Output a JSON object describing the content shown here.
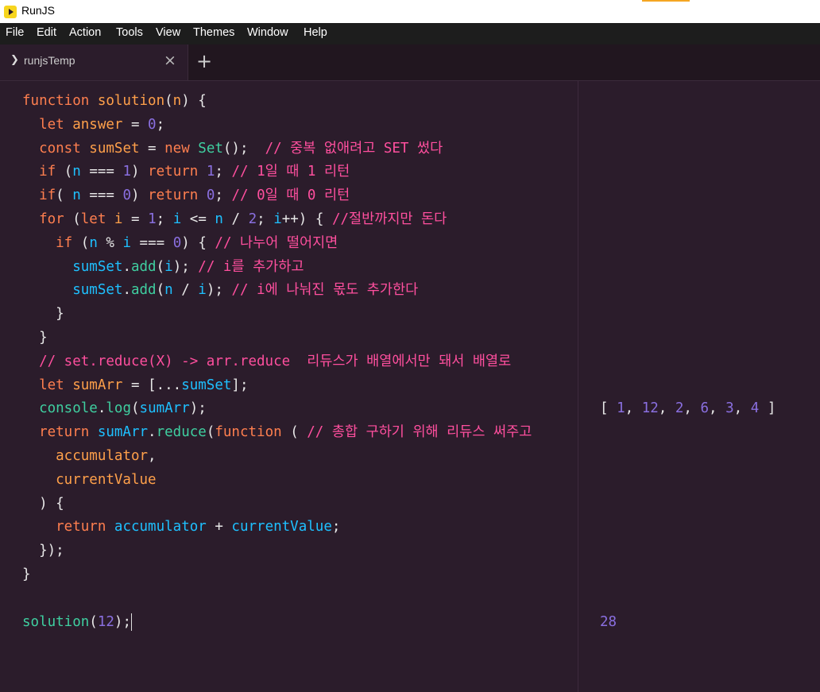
{
  "window": {
    "title": "RunJS"
  },
  "menu": [
    "File",
    "Edit",
    "Action",
    "Tools",
    "View",
    "Themes",
    "Window",
    "Help"
  ],
  "tab": {
    "name": "runjsTemp",
    "close_icon": "×",
    "chevron": "❯",
    "new_tab_icon": "+"
  },
  "code": [
    [
      [
        "function ",
        "kw"
      ],
      [
        "solution",
        "fn"
      ],
      [
        "(",
        "pl"
      ],
      [
        "n",
        "fn"
      ],
      [
        ") {",
        "pl"
      ]
    ],
    [
      [
        "  let ",
        "kw"
      ],
      [
        "answer",
        "fn"
      ],
      [
        " = ",
        "pl"
      ],
      [
        "0",
        "num"
      ],
      [
        ";",
        "pl"
      ]
    ],
    [
      [
        "  const ",
        "kw"
      ],
      [
        "sumSet",
        "fn"
      ],
      [
        " = ",
        "pl"
      ],
      [
        "new ",
        "kw"
      ],
      [
        "Set",
        "bi"
      ],
      [
        "();  ",
        "pl"
      ],
      [
        "// 중복 없애려고 SET 썼다",
        "cmt"
      ]
    ],
    [
      [
        "  if ",
        "kw"
      ],
      [
        "(",
        "pl"
      ],
      [
        "n",
        "id"
      ],
      [
        " === ",
        "pl"
      ],
      [
        "1",
        "num"
      ],
      [
        ") ",
        "pl"
      ],
      [
        "return ",
        "kw"
      ],
      [
        "1",
        "num"
      ],
      [
        "; ",
        "pl"
      ],
      [
        "// 1일 때 1 리턴",
        "cmt"
      ]
    ],
    [
      [
        "  if",
        "kw"
      ],
      [
        "( ",
        "pl"
      ],
      [
        "n",
        "id"
      ],
      [
        " === ",
        "pl"
      ],
      [
        "0",
        "num"
      ],
      [
        ") ",
        "pl"
      ],
      [
        "return ",
        "kw"
      ],
      [
        "0",
        "num"
      ],
      [
        "; ",
        "pl"
      ],
      [
        "// 0일 때 0 리턴",
        "cmt"
      ]
    ],
    [
      [
        "  for ",
        "kw"
      ],
      [
        "(",
        "pl"
      ],
      [
        "let ",
        "kw"
      ],
      [
        "i",
        "fn"
      ],
      [
        " = ",
        "pl"
      ],
      [
        "1",
        "num"
      ],
      [
        "; ",
        "pl"
      ],
      [
        "i",
        "id"
      ],
      [
        " <= ",
        "pl"
      ],
      [
        "n",
        "id"
      ],
      [
        " / ",
        "pl"
      ],
      [
        "2",
        "num"
      ],
      [
        "; ",
        "pl"
      ],
      [
        "i",
        "id"
      ],
      [
        "++) { ",
        "pl"
      ],
      [
        "//절반까지만 돈다",
        "cmt"
      ]
    ],
    [
      [
        "    if ",
        "kw"
      ],
      [
        "(",
        "pl"
      ],
      [
        "n",
        "id"
      ],
      [
        " % ",
        "pl"
      ],
      [
        "i",
        "id"
      ],
      [
        " === ",
        "pl"
      ],
      [
        "0",
        "num"
      ],
      [
        ") { ",
        "pl"
      ],
      [
        "// 나누어 떨어지면",
        "cmt"
      ]
    ],
    [
      [
        "      ",
        "pl"
      ],
      [
        "sumSet",
        "id"
      ],
      [
        ".",
        "pl"
      ],
      [
        "add",
        "bi"
      ],
      [
        "(",
        "pl"
      ],
      [
        "i",
        "id"
      ],
      [
        "); ",
        "pl"
      ],
      [
        "// i를 추가하고",
        "cmt"
      ]
    ],
    [
      [
        "      ",
        "pl"
      ],
      [
        "sumSet",
        "id"
      ],
      [
        ".",
        "pl"
      ],
      [
        "add",
        "bi"
      ],
      [
        "(",
        "pl"
      ],
      [
        "n",
        "id"
      ],
      [
        " / ",
        "pl"
      ],
      [
        "i",
        "id"
      ],
      [
        "); ",
        "pl"
      ],
      [
        "// i에 나눠진 몫도 추가한다",
        "cmt"
      ]
    ],
    [
      [
        "    }",
        "pl"
      ]
    ],
    [
      [
        "  }",
        "pl"
      ]
    ],
    [
      [
        "  // set.reduce(X) -> arr.reduce  리듀스가 배열에서만 돼서 배열로",
        "cmt"
      ]
    ],
    [
      [
        "  let ",
        "kw"
      ],
      [
        "sumArr",
        "fn"
      ],
      [
        " = [...",
        "pl"
      ],
      [
        "sumSet",
        "id"
      ],
      [
        "];",
        "pl"
      ]
    ],
    [
      [
        "  console",
        "bi"
      ],
      [
        ".",
        "pl"
      ],
      [
        "log",
        "bi"
      ],
      [
        "(",
        "pl"
      ],
      [
        "sumArr",
        "id"
      ],
      [
        ");",
        "pl"
      ]
    ],
    [
      [
        "  return ",
        "kw"
      ],
      [
        "sumArr",
        "id"
      ],
      [
        ".",
        "pl"
      ],
      [
        "reduce",
        "bi"
      ],
      [
        "(",
        "pl"
      ],
      [
        "function",
        "kw"
      ],
      [
        " ( ",
        "pl"
      ],
      [
        "// 총합 구하기 위해 리듀스 써주고",
        "cmt"
      ]
    ],
    [
      [
        "    accumulator",
        "fn"
      ],
      [
        ",",
        "pl"
      ]
    ],
    [
      [
        "    currentValue",
        "fn"
      ]
    ],
    [
      [
        "  ) {",
        "pl"
      ]
    ],
    [
      [
        "    return ",
        "kw"
      ],
      [
        "accumulator",
        "id"
      ],
      [
        " + ",
        "pl"
      ],
      [
        "currentValue",
        "id"
      ],
      [
        ";",
        "pl"
      ]
    ],
    [
      [
        "  });",
        "pl"
      ]
    ],
    [
      [
        "}",
        "pl"
      ]
    ],
    [
      [
        "",
        "pl"
      ]
    ],
    [
      [
        "solution",
        "bi"
      ],
      [
        "(",
        "pl"
      ],
      [
        "12",
        "num"
      ],
      [
        ");",
        "pl"
      ]
    ]
  ],
  "results": {
    "log_output": [
      [
        "[ ",
        "rb"
      ],
      [
        "1",
        "rn"
      ],
      [
        ", ",
        "rb"
      ],
      [
        "12",
        "rn"
      ],
      [
        ", ",
        "rb"
      ],
      [
        "2",
        "rn"
      ],
      [
        ", ",
        "rb"
      ],
      [
        "6",
        "rn"
      ],
      [
        ", ",
        "rb"
      ],
      [
        "3",
        "rn"
      ],
      [
        ", ",
        "rb"
      ],
      [
        "4",
        "rn"
      ],
      [
        " ]",
        "rb"
      ]
    ],
    "return_value": "28"
  }
}
